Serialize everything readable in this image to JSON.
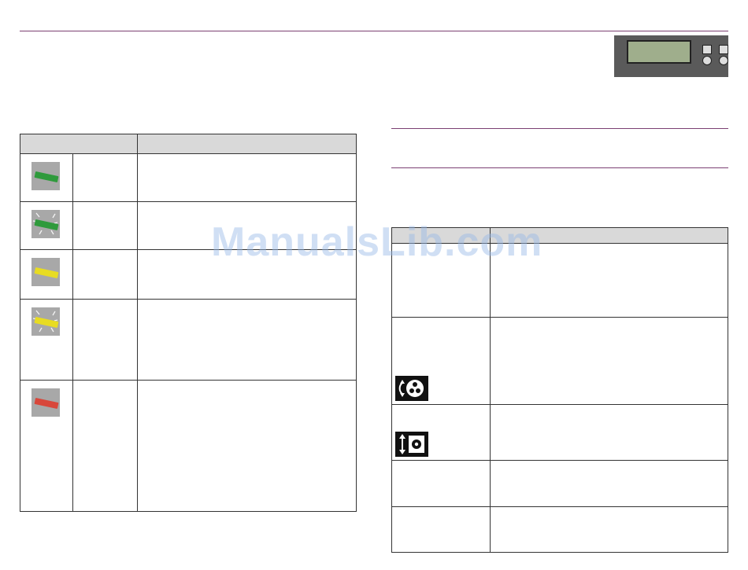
{
  "watermark": "ManualsLib.com",
  "left_table": {
    "rows": [
      {
        "color": "#2f9a3c",
        "flashing": false
      },
      {
        "color": "#2f9a3c",
        "flashing": true
      },
      {
        "color": "#e8dc22",
        "flashing": false
      },
      {
        "color": "#e8dc22",
        "flashing": true
      },
      {
        "color": "#d8473b",
        "flashing": false
      }
    ]
  },
  "right_table": {
    "rows": [
      {
        "icon": "none"
      },
      {
        "icon": "paper-roll-load-icon"
      },
      {
        "icon": "ink-cartridge-lift-icon"
      },
      {
        "icon": "none"
      },
      {
        "icon": "none"
      }
    ]
  },
  "panel_icons": [
    "lcd-display",
    "panel-button",
    "panel-button"
  ]
}
